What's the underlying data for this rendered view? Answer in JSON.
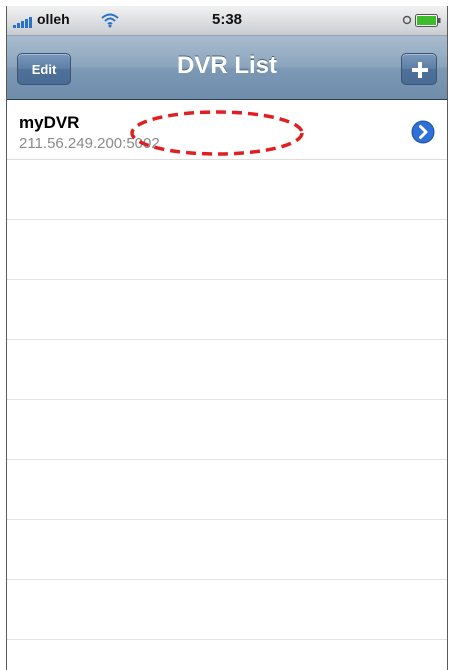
{
  "status_bar": {
    "carrier": "olleh",
    "time": "5:38",
    "icons": [
      "signal-icon",
      "wifi-icon",
      "lock-icon",
      "battery-icon"
    ]
  },
  "nav_bar": {
    "title": "DVR List",
    "edit_label": "Edit",
    "add_icon": "plus-icon"
  },
  "list": {
    "items": [
      {
        "name": "myDVR",
        "address": "211.56.249.200:5002",
        "accessory_icon": "disclosure-button-icon"
      }
    ],
    "empty_rows": 8
  },
  "colors": {
    "nav_bar": "#8ca5bd",
    "nav_button": "#5c7ea6",
    "disclosure": "#2f6fd8",
    "annotation": "#e02020",
    "battery": "#3cbd2a"
  }
}
